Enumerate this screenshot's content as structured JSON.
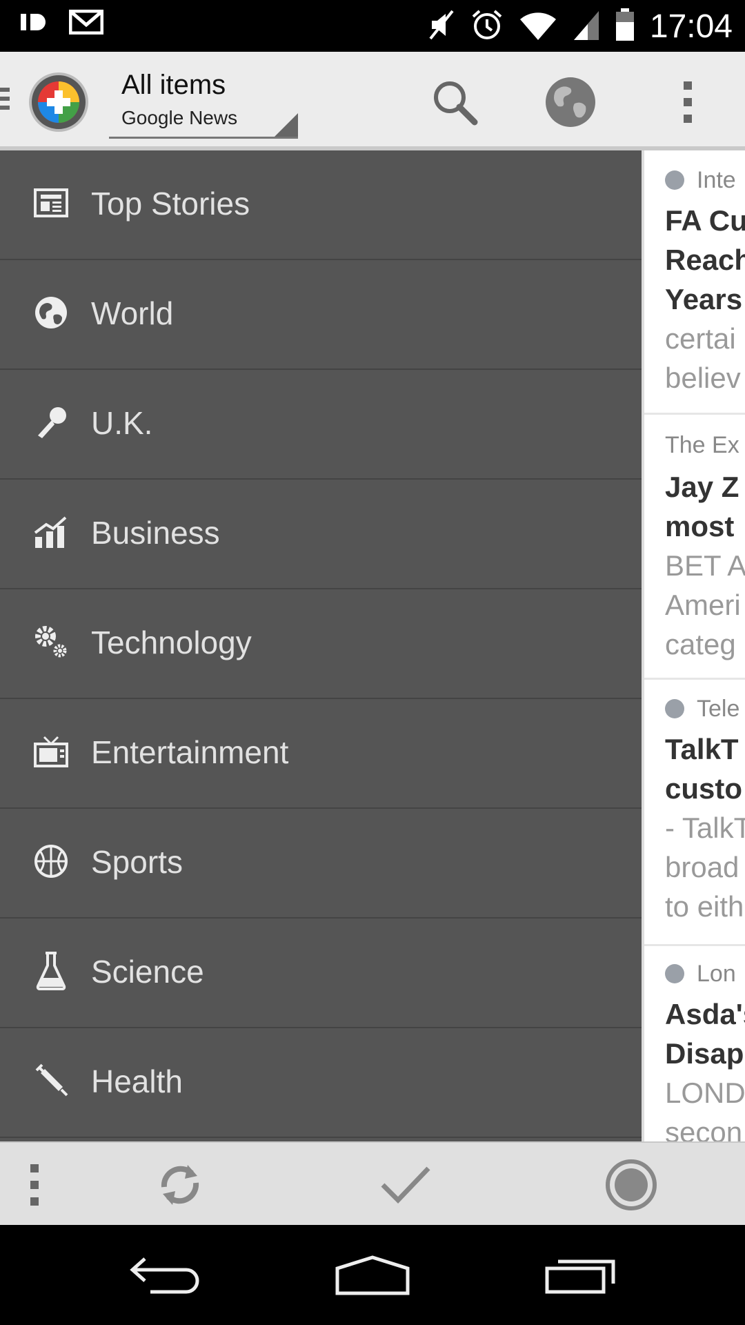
{
  "status_bar": {
    "time": "17:04",
    "icons": [
      "dolby-icon",
      "gmail-icon",
      "mute-icon",
      "alarm-icon",
      "wifi-icon",
      "signal-icon",
      "battery-icon"
    ]
  },
  "action_bar": {
    "title": "All items",
    "subtitle": "Google News",
    "icons": [
      "search-icon",
      "globe-icon",
      "overflow-menu-icon"
    ]
  },
  "drawer": {
    "items": [
      {
        "label": "Top Stories",
        "icon": "newspaper-icon"
      },
      {
        "label": "World",
        "icon": "globe-icon"
      },
      {
        "label": "U.K.",
        "icon": "microphone-icon"
      },
      {
        "label": "Business",
        "icon": "chart-icon"
      },
      {
        "label": "Technology",
        "icon": "gears-icon"
      },
      {
        "label": "Entertainment",
        "icon": "tv-icon"
      },
      {
        "label": "Sports",
        "icon": "ball-icon"
      },
      {
        "label": "Science",
        "icon": "flask-icon"
      },
      {
        "label": "Health",
        "icon": "syringe-icon"
      }
    ]
  },
  "articles": [
    {
      "source": "Inte",
      "headline_lines": [
        "FA Cu",
        "Reach",
        "Years"
      ],
      "body_lines": [
        "certai",
        "believ"
      ]
    },
    {
      "source": "The Ex",
      "headline_lines": [
        "Jay Z",
        "most "
      ],
      "body_lines": [
        "BET A",
        "Ameri",
        "categ"
      ]
    },
    {
      "source": "Tele",
      "headline_lines": [
        "TalkT",
        "custo"
      ],
      "body_lines": [
        "- TalkT",
        "broad",
        "to eith"
      ]
    },
    {
      "source": "Lon",
      "headline_lines": [
        "Asda's",
        "Disap"
      ],
      "body_lines": [
        "LOND",
        "secon"
      ]
    }
  ],
  "toolbar": {
    "icons": [
      "overflow-menu-icon",
      "refresh-icon",
      "mark-read-icon",
      "record-icon"
    ]
  },
  "nav_bar": {
    "icons": [
      "back-icon",
      "home-icon",
      "recents-icon"
    ]
  },
  "colors": {
    "drawer_bg": "#555555",
    "action_bar_bg": "#ececec",
    "toolbar_bg": "#e0e0e0"
  }
}
